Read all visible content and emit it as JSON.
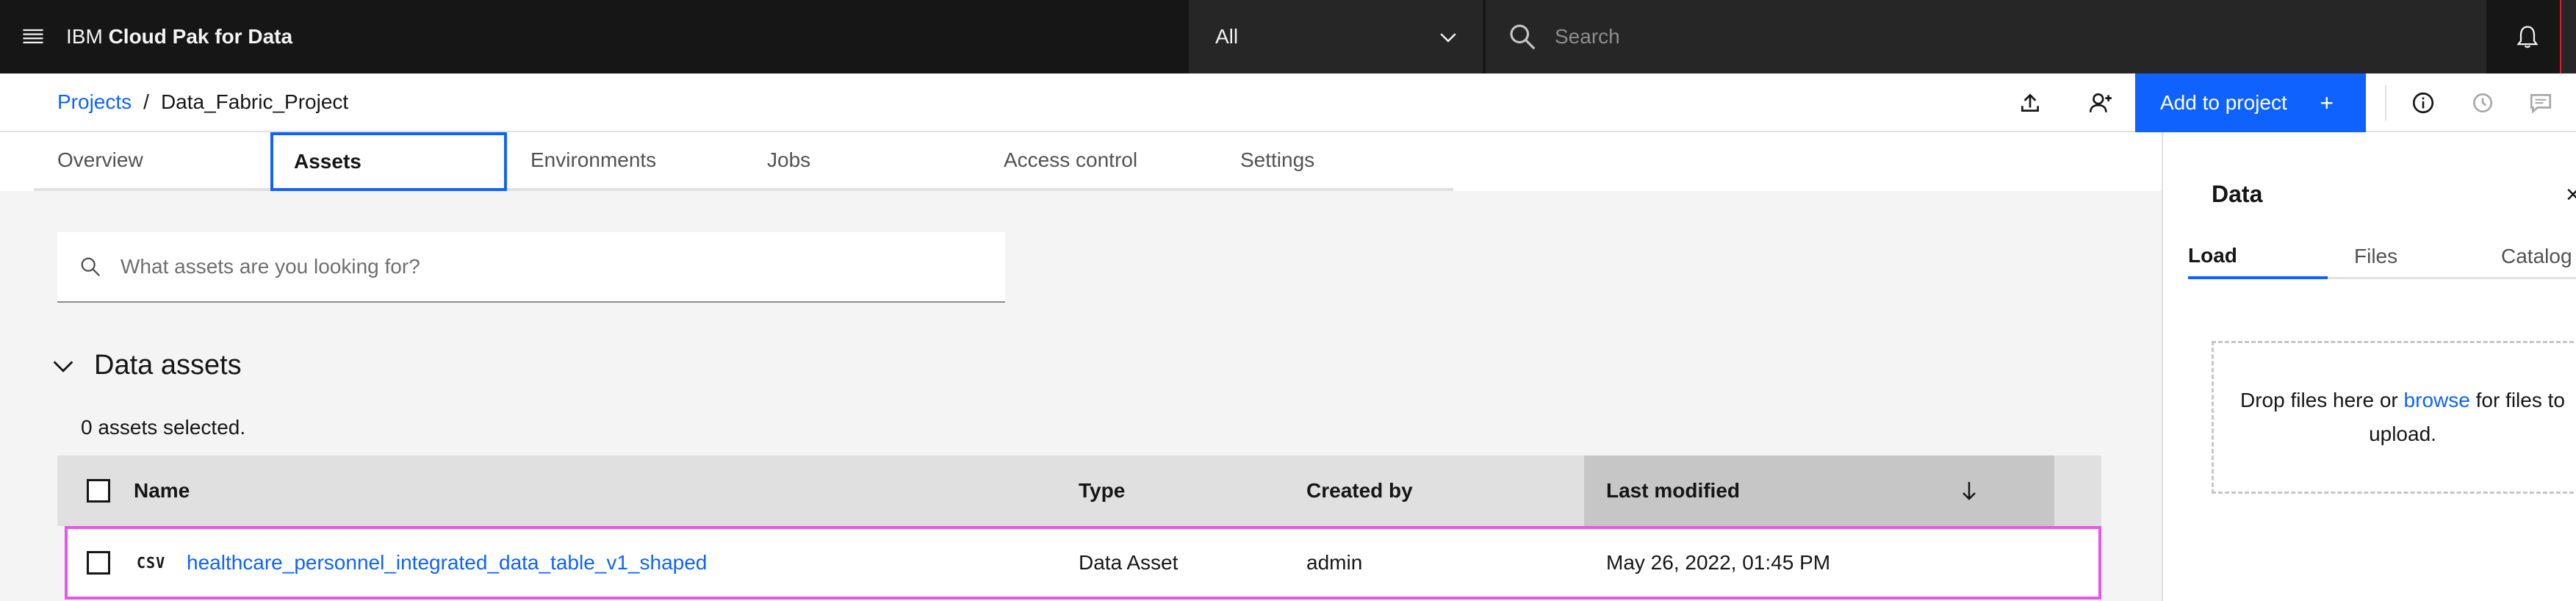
{
  "header": {
    "brand_prefix": "IBM",
    "brand_name": "Cloud Pak for Data",
    "scope_value": "All",
    "search_placeholder": "Search"
  },
  "breadcrumb": {
    "root": "Projects",
    "separator": "/",
    "current": "Data_Fabric_Project"
  },
  "toolbar": {
    "add_label": "Add to project",
    "add_plus": "+"
  },
  "tabs": [
    {
      "label": "Overview"
    },
    {
      "label": "Assets"
    },
    {
      "label": "Environments"
    },
    {
      "label": "Jobs"
    },
    {
      "label": "Access control"
    },
    {
      "label": "Settings"
    }
  ],
  "assets": {
    "search_placeholder": "What assets are you looking for?",
    "section_title": "Data assets",
    "selected_count": "0 assets selected.",
    "columns": [
      "Name",
      "Type",
      "Created by",
      "Last modified"
    ],
    "rows": [
      {
        "icon": "CSV",
        "name": "healthcare_personnel_integrated_data_table_v1_shaped",
        "type": "Data Asset",
        "created_by": "admin",
        "last_modified": "May 26, 2022, 01:45 PM"
      }
    ]
  },
  "panel": {
    "title": "Data",
    "close": "×",
    "tabs": [
      "Load",
      "Files",
      "Catalog"
    ],
    "drop_text_1": "Drop files here or ",
    "browse": "browse",
    "drop_text_2": " for files to upload."
  },
  "colors": {
    "accent": "#0f62fe",
    "topbar": "#161616",
    "highlight": "#e855e8"
  }
}
